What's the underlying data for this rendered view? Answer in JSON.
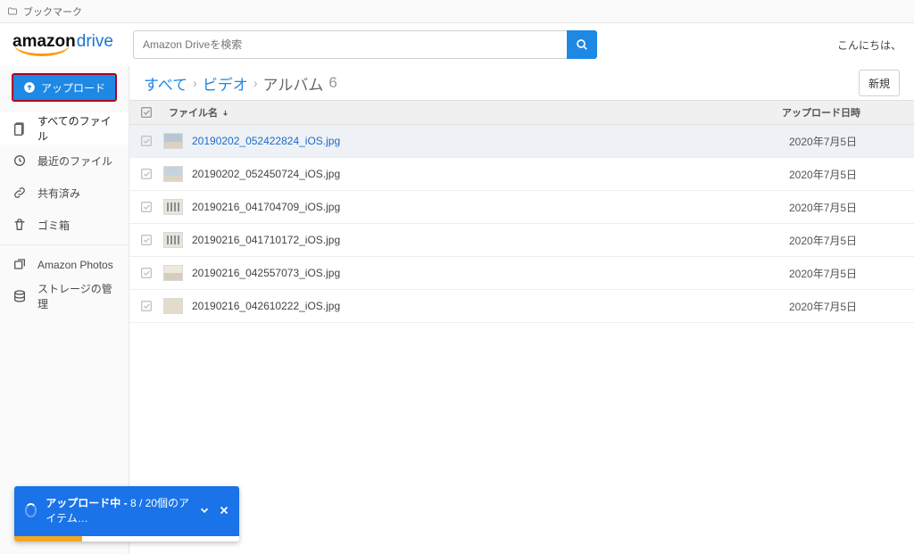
{
  "bookmark_label": "ブックマーク",
  "logo": {
    "part1": "amazon",
    "part2": "drive"
  },
  "search": {
    "placeholder": "Amazon Driveを検索"
  },
  "greeting": "こんにちは、",
  "upload_button": "アップロード",
  "nav": {
    "all_files": "すべてのファイル",
    "recent": "最近のファイル",
    "shared": "共有済み",
    "trash": "ゴミ箱",
    "photos": "Amazon Photos",
    "storage": "ストレージの管理"
  },
  "breadcrumb": {
    "root": "すべて",
    "sep": "›",
    "videos": "ビデオ",
    "current": "アルバム",
    "count": "6"
  },
  "new_button": "新規",
  "columns": {
    "name": "ファイル名",
    "upload_date": "アップロード日時"
  },
  "rows": [
    {
      "name": "20190202_052422824_iOS.jpg",
      "date": "2020年7月5日",
      "selected": true,
      "thumb": "sky"
    },
    {
      "name": "20190202_052450724_iOS.jpg",
      "date": "2020年7月5日",
      "selected": false,
      "thumb": "sky2"
    },
    {
      "name": "20190216_041704709_iOS.jpg",
      "date": "2020年7月5日",
      "selected": false,
      "thumb": "ppl"
    },
    {
      "name": "20190216_041710172_iOS.jpg",
      "date": "2020年7月5日",
      "selected": false,
      "thumb": "ppl"
    },
    {
      "name": "20190216_042557073_iOS.jpg",
      "date": "2020年7月5日",
      "selected": false,
      "thumb": "room"
    },
    {
      "name": "20190216_042610222_iOS.jpg",
      "date": "2020年7月5日",
      "selected": false,
      "thumb": "flat"
    }
  ],
  "toast": {
    "title_prefix": "アップロード中 - ",
    "progress_text": "8 / 20個のアイテム…"
  }
}
